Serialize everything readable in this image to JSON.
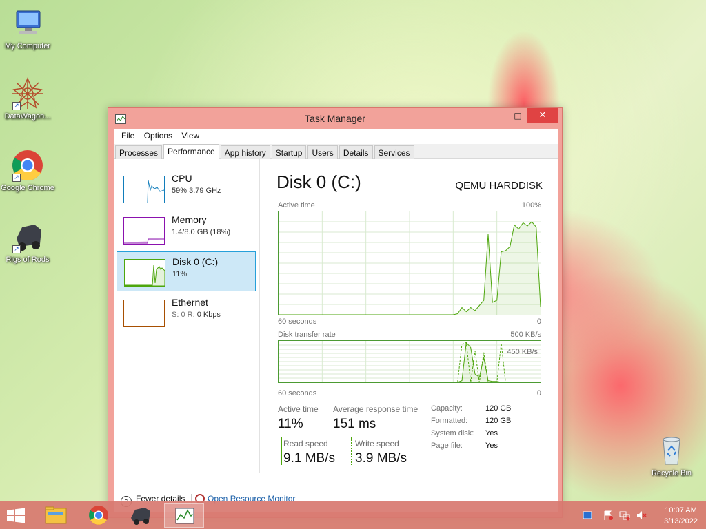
{
  "desktop": {
    "icons": [
      {
        "label": "My Computer"
      },
      {
        "label": "DataWagon..."
      },
      {
        "label": "Google Chrome"
      },
      {
        "label": "Rigs of Rods"
      },
      {
        "label": "Recycle Bin"
      }
    ]
  },
  "window": {
    "title": "Task Manager",
    "min_icon": "minimize-icon",
    "max_icon": "maximize-icon",
    "close_icon": "close-icon"
  },
  "menu": [
    "File",
    "Options",
    "View"
  ],
  "tabs": [
    "Processes",
    "Performance",
    "App history",
    "Startup",
    "Users",
    "Details",
    "Services"
  ],
  "active_tab": "Performance",
  "resources": [
    {
      "name": "CPU",
      "sub": "59%  3.79 GHz",
      "color": "#117dbb"
    },
    {
      "name": "Memory",
      "sub": "1.4/8.0 GB (18%)",
      "color": "#8b12ae"
    },
    {
      "name": "Disk 0 (C:)",
      "sub": "11%",
      "color": "#4da60c"
    },
    {
      "name": "Ethernet",
      "sub_prefix": "S: 0 R:",
      "sub": "0 Kbps",
      "color": "#a74f01"
    }
  ],
  "detail": {
    "title": "Disk 0 (C:)",
    "model": "QEMU HARDDISK",
    "active_time_label": "Active time",
    "active_time_max": "100%",
    "active_x_left": "60 seconds",
    "active_x_right": "0",
    "transfer_label": "Disk transfer rate",
    "transfer_max": "500 KB/s",
    "transfer_marker": "450 KB/s",
    "transfer_x_left": "60 seconds",
    "transfer_x_right": "0",
    "stats": {
      "active_time": {
        "label": "Active time",
        "value": "11%"
      },
      "avg_response": {
        "label": "Average response time",
        "value": "151 ms"
      },
      "read_speed": {
        "label": "Read speed",
        "value": "9.1 MB/s"
      },
      "write_speed": {
        "label": "Write speed",
        "value": "3.9 MB/s"
      }
    },
    "props": [
      {
        "key": "Capacity:",
        "value": "120 GB"
      },
      {
        "key": "Formatted:",
        "value": "120 GB"
      },
      {
        "key": "System disk:",
        "value": "Yes"
      },
      {
        "key": "Page file:",
        "value": "Yes"
      }
    ]
  },
  "footer": {
    "fewer_details": "Fewer details",
    "resource_monitor": "Open Resource Monitor"
  },
  "chart_data": [
    {
      "type": "area",
      "title": "Active time",
      "xlabel": "60 seconds",
      "ylim": [
        0,
        100
      ],
      "x": [
        0,
        1,
        2,
        3,
        4,
        5,
        6,
        7,
        8,
        9,
        10,
        11,
        12,
        13,
        14,
        15,
        16,
        17,
        18,
        19,
        20,
        21,
        22,
        23,
        24,
        25,
        26,
        27,
        28,
        29,
        30,
        31,
        32,
        33,
        34,
        35,
        36,
        37,
        38,
        39,
        40,
        41,
        42,
        43,
        44,
        45,
        46,
        47,
        48,
        49,
        50,
        51,
        52,
        53,
        54,
        55,
        56,
        57,
        58,
        59,
        60
      ],
      "series": [
        {
          "values": [
            0,
            0,
            0,
            0,
            0,
            0,
            0,
            0,
            0,
            0,
            0,
            0,
            0,
            0,
            0,
            0,
            0,
            0,
            0,
            0,
            0,
            0,
            0,
            0,
            0,
            0,
            0,
            0,
            0,
            0,
            0,
            0,
            0,
            0,
            0,
            0,
            0,
            0,
            0,
            0,
            0,
            1,
            7,
            3,
            7,
            4,
            9,
            14,
            78,
            12,
            14,
            61,
            62,
            66,
            87,
            83,
            89,
            86,
            90,
            85,
            8
          ]
        }
      ]
    },
    {
      "type": "area",
      "title": "Disk transfer rate",
      "xlabel": "60 seconds",
      "ylim": [
        0,
        500
      ],
      "x": [
        0,
        1,
        2,
        3,
        4,
        5,
        6,
        7,
        8,
        9,
        10,
        11,
        12,
        13,
        14,
        15,
        16,
        17,
        18,
        19,
        20,
        21,
        22,
        23,
        24,
        25,
        26,
        27,
        28,
        29,
        30,
        31,
        32,
        33,
        34,
        35,
        36,
        37,
        38,
        39,
        40,
        41,
        42,
        43,
        44,
        45,
        46,
        47,
        48,
        49,
        50,
        51,
        52,
        53,
        54,
        55,
        56,
        57,
        58,
        59,
        60
      ],
      "series": [
        {
          "values": [
            0,
            0,
            0,
            0,
            0,
            0,
            0,
            0,
            0,
            0,
            0,
            0,
            0,
            0,
            0,
            0,
            0,
            0,
            0,
            0,
            0,
            0,
            0,
            0,
            0,
            0,
            0,
            0,
            0,
            0,
            0,
            0,
            0,
            0,
            0,
            0,
            0,
            0,
            0,
            0,
            0,
            0,
            20,
            480,
            420,
            100,
            60,
            300,
            20,
            10,
            10,
            0,
            0,
            0,
            0,
            0,
            0,
            0,
            0,
            0,
            0
          ]
        },
        {
          "values": [
            0,
            0,
            0,
            0,
            0,
            0,
            0,
            0,
            0,
            0,
            0,
            0,
            0,
            0,
            0,
            0,
            0,
            0,
            0,
            0,
            0,
            0,
            0,
            0,
            0,
            0,
            0,
            0,
            0,
            0,
            0,
            0,
            0,
            0,
            0,
            0,
            0,
            0,
            0,
            0,
            0,
            0,
            460,
            480,
            0,
            380,
            0,
            360,
            0,
            0,
            0,
            470,
            0,
            0,
            0,
            0,
            0,
            0,
            0,
            0,
            0
          ]
        }
      ]
    }
  ]
}
